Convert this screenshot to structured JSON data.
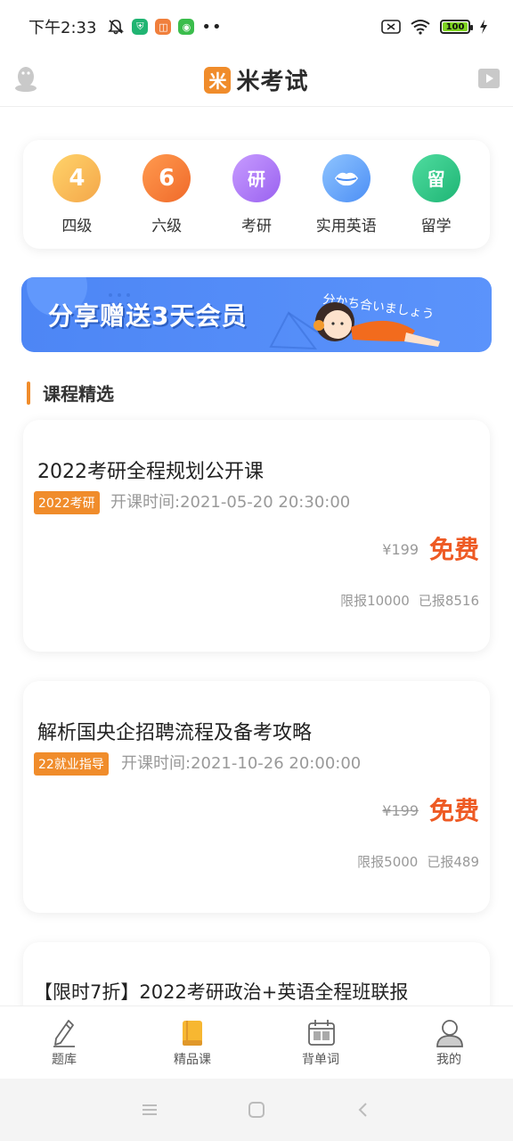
{
  "status_bar": {
    "time": "下午2:33",
    "battery": "100",
    "colors": {
      "app1": "#20b472",
      "app2": "#f07f3c",
      "app3": "#3bbd4c",
      "battery_fill": "#7ed321"
    }
  },
  "header": {
    "brand_logo_char": "米",
    "brand_name": "米考试",
    "left_icon": "qq-penguin-icon",
    "right_icon": "video-play-icon"
  },
  "categories": [
    {
      "label": "四级",
      "glyph": "4",
      "color_from": "#ffd36a",
      "color_to": "#f4a74a"
    },
    {
      "label": "六级",
      "glyph": "6",
      "color_from": "#ff9a4f",
      "color_to": "#f06a2a"
    },
    {
      "label": "考研",
      "glyph": "研",
      "color_from": "#c79bff",
      "color_to": "#9a62f0"
    },
    {
      "label": "实用英语",
      "glyph": "",
      "color_from": "#8ec4ff",
      "color_to": "#4d8ff5"
    },
    {
      "label": "留学",
      "glyph": "留",
      "color_from": "#4fdc9f",
      "color_to": "#1fb575"
    }
  ],
  "banner": {
    "title": "分享赠送3天会员",
    "subtitle": "分かち合いましょう"
  },
  "section": {
    "title": "课程精选"
  },
  "courses": [
    {
      "title": "2022考研全程规划公开课",
      "tag": "2022考研",
      "time": "开课时间:2021-05-20 20:30:00",
      "original_price": "¥199",
      "price": "免费",
      "limit": "限报10000",
      "enrolled": "已报8516"
    },
    {
      "title": "解析国央企招聘流程及备考攻略",
      "tag": "22就业指导",
      "time": "开课时间:2021-10-26 20:00:00",
      "original_price": "¥199",
      "price": "免费",
      "limit": "限报5000",
      "enrolled": "已报489"
    },
    {
      "title": "【限时7折】2022考研政治+英语全程班联报"
    }
  ],
  "bottom_nav": [
    {
      "label": "题库",
      "icon": "pencil-icon"
    },
    {
      "label": "精品课",
      "icon": "book-icon"
    },
    {
      "label": "背单词",
      "icon": "calendar-icon"
    },
    {
      "label": "我的",
      "icon": "user-icon"
    }
  ]
}
